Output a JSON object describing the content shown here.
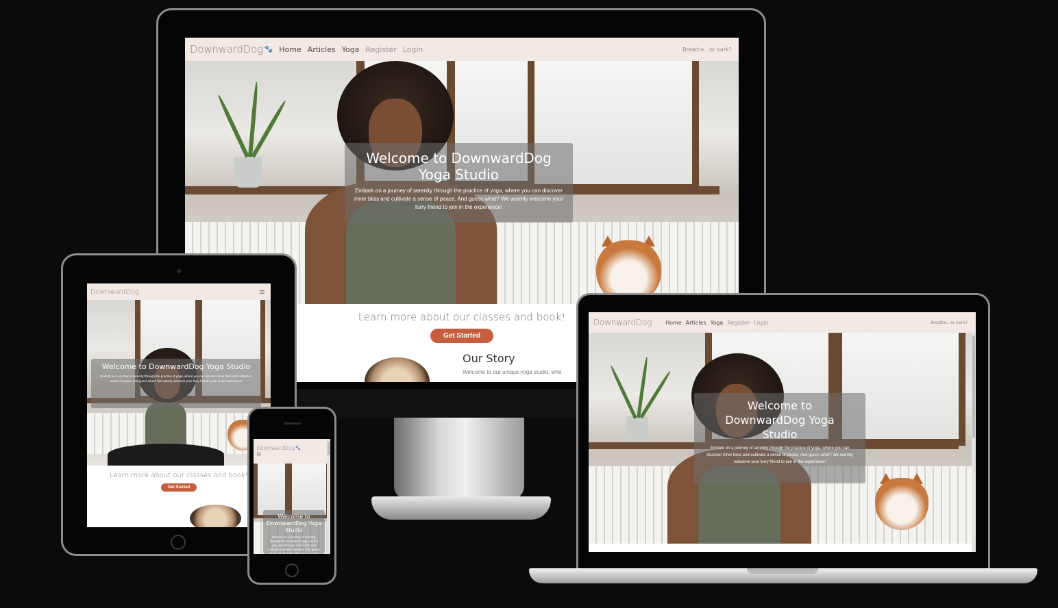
{
  "site": {
    "brand": "DownwardDog",
    "nav": {
      "home": "Home",
      "articles": "Articles",
      "yoga": "Yoga",
      "register": "Register",
      "login": "Login"
    },
    "tagline": "Breathe.. or bark?",
    "hero": {
      "title": "Welcome to DownwardDog Yoga Studio",
      "title_desktop_line1": "Welcome to DownwardDog",
      "title_desktop_line2": "Yoga Studio",
      "text": "Embark on a journey of serenity through the practice of yoga, where you can discover inner bliss and cultivate a sense of peace. And guess what? We warmly welcome your furry friend to join in the experience!"
    },
    "cta": {
      "text": "Learn more about our classes and book!",
      "button": "Get Started"
    },
    "story": {
      "title": "Our Story",
      "text": "Welcome to our unique yoga studio, whe"
    },
    "hamburger_glyph": "≡",
    "paw_glyph": "🐾"
  },
  "colors": {
    "background": "#0b0b0b",
    "navbar": "#f2e9e4",
    "accent": "#c45e3d"
  }
}
